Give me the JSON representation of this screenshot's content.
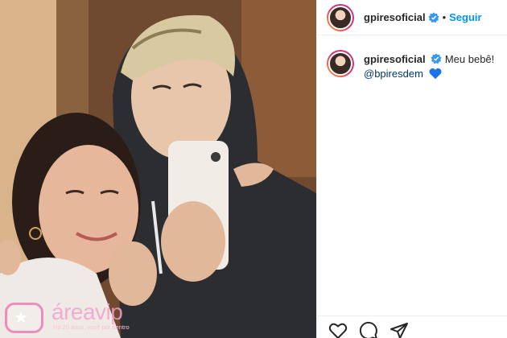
{
  "post": {
    "username": "gpiresoficial",
    "follow_label": "Seguir",
    "separator": "•",
    "caption": "Meu bebê!",
    "mention": "@bpiresdem",
    "heart_color": "#1a73e8"
  },
  "watermark": {
    "name": "áreavip",
    "tagline": "Há 20 anos, você por dentro"
  },
  "icons": {
    "like": "heart-outline-icon",
    "comment": "comment-bubble-icon",
    "share": "paper-plane-icon",
    "verified": "verified-badge-icon"
  },
  "colors": {
    "link_blue": "#0095f6",
    "verified_blue": "#3897f0",
    "border": "#efefef"
  }
}
